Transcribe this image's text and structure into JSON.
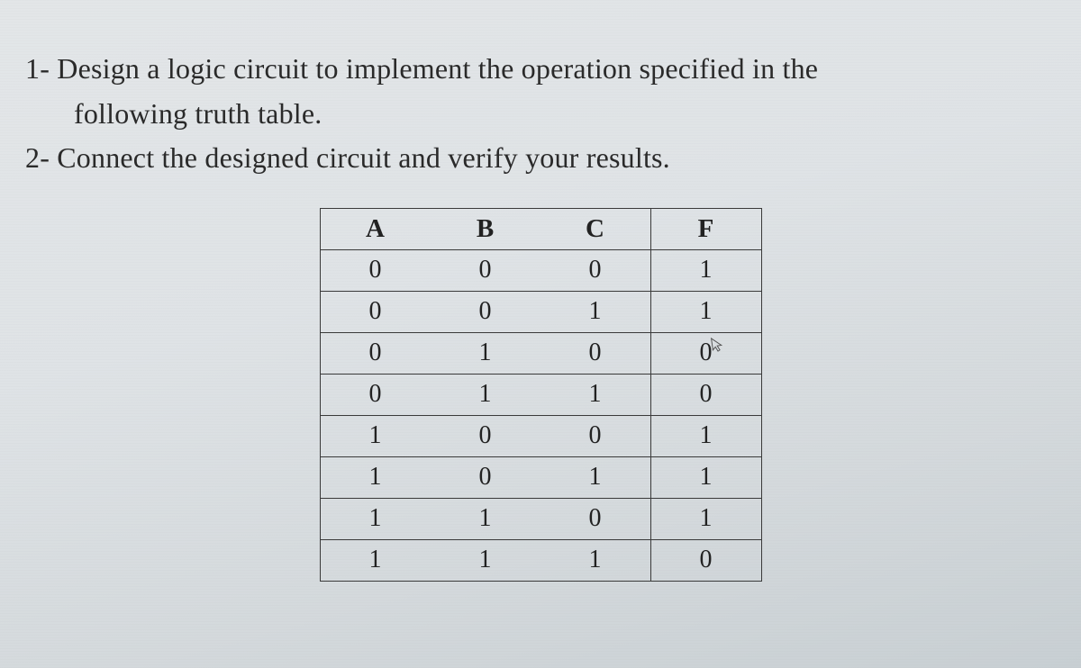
{
  "questions": {
    "q1_line1": "1- Design a logic circuit to implement the operation specified in the",
    "q1_line2": "following truth table.",
    "q2": "2- Connect the designed circuit and verify your results."
  },
  "chart_data": {
    "type": "table",
    "title": "Truth table",
    "headers": [
      "A",
      "B",
      "C",
      "F"
    ],
    "rows": [
      [
        "0",
        "0",
        "0",
        "1"
      ],
      [
        "0",
        "0",
        "1",
        "1"
      ],
      [
        "0",
        "1",
        "0",
        "0"
      ],
      [
        "0",
        "1",
        "1",
        "0"
      ],
      [
        "1",
        "0",
        "0",
        "1"
      ],
      [
        "1",
        "0",
        "1",
        "1"
      ],
      [
        "1",
        "1",
        "0",
        "1"
      ],
      [
        "1",
        "1",
        "1",
        "0"
      ]
    ]
  },
  "cursor_glyph": "↖"
}
